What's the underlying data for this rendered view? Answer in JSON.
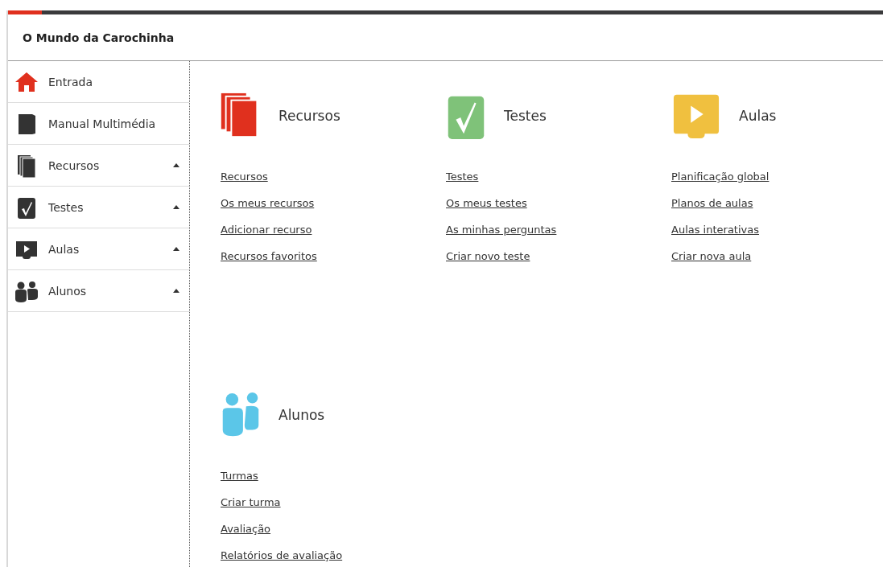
{
  "header": {
    "title": "O Mundo da Carochinha"
  },
  "sidebar": {
    "items": [
      {
        "kind": "home",
        "label": "Entrada"
      },
      {
        "kind": "book",
        "label": "Manual Multimédia"
      },
      {
        "kind": "resources",
        "label": "Recursos",
        "expanded": true
      },
      {
        "kind": "tests",
        "label": "Testes",
        "expanded": true
      },
      {
        "kind": "lessons",
        "label": "Aulas",
        "expanded": true
      },
      {
        "kind": "students",
        "label": "Alunos",
        "expanded": true
      }
    ]
  },
  "sections": [
    {
      "kind": "resources",
      "title": "Recursos",
      "links": [
        "Recursos",
        "Os meus recursos",
        "Adicionar recurso",
        "Recursos favoritos"
      ]
    },
    {
      "kind": "tests",
      "title": "Testes",
      "links": [
        "Testes",
        "Os meus testes",
        "As minhas perguntas",
        "Criar novo teste"
      ]
    },
    {
      "kind": "lessons",
      "title": "Aulas",
      "links": [
        "Planificação global",
        "Planos de aulas",
        "Aulas interativas",
        "Criar nova aula"
      ]
    },
    {
      "kind": "students",
      "title": "Alunos",
      "links": [
        "Turmas",
        "Criar turma",
        "Avaliação",
        "Relatórios de avaliação"
      ]
    }
  ]
}
